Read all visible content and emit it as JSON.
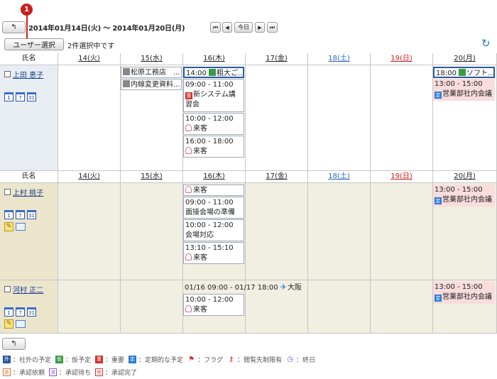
{
  "callout": "1",
  "toolbar": {
    "back_glyph": "↰",
    "date_range": "2014年01月14日(火) 〜 2014年01月20日(月)",
    "nav": [
      "⏮",
      "◀",
      "今日",
      "▶",
      "⏭"
    ]
  },
  "selection": {
    "button": "ユーザー選択",
    "status": "2件選択中です"
  },
  "refresh_glyph": "↻",
  "header": {
    "name_col": "氏名",
    "days": [
      "14(火)",
      "15(水)",
      "16(木)",
      "17(金)",
      "18(土)",
      "19(日)",
      "20(月)"
    ]
  },
  "users": [
    {
      "name": "上田 恵子",
      "icons": [
        "1",
        "7",
        "31"
      ]
    },
    {
      "name": "上村 桃子",
      "icons": [
        "1",
        "7",
        "31"
      ]
    },
    {
      "name": "河村 正二",
      "icons": [
        "1",
        "7",
        "31"
      ]
    }
  ],
  "events": {
    "u1_d15_a": "松原工務店　...",
    "u1_d15_b": "内線変更資料...",
    "u1_d16_a": "14:00 ",
    "u1_d16_a_title": "粗大ご...",
    "u1_d16_b_time": "09:00 - 11:00",
    "u1_d16_b_title": "新システム講習会",
    "u1_d16_c_time": "10:00 - 12:00",
    "u1_d16_c_title": "来客",
    "u1_d16_d_time": "16:00 - 18:00",
    "u1_d16_d_title": "来客",
    "u1_d20_a": "18:00 ",
    "u1_d20_a_title": "ソフト...",
    "u1_d20_b_time": "13:00 - 15:00",
    "u1_d20_b_title": "営業部社内会議",
    "u2_d16_a_title": "来客",
    "u2_d16_b_time": "09:00 - 11:00",
    "u2_d16_b_title": "面接会場の準備",
    "u2_d16_c_time": "10:00 - 12:00",
    "u2_d16_c_title": "会場対応",
    "u2_d16_d_time": "13:10 - 15:10",
    "u2_d16_d_title": "来客",
    "u2_d20_a_time": "13:00 - 15:00",
    "u2_d20_a_title": "営業部社内会議",
    "u3_span_time": "01/16 09:00 - 01/17 18:00 ",
    "u3_span_title": "大阪出張",
    "u3_d16_b_time": "10:00 - 12:00",
    "u3_d16_b_title": "来客",
    "u3_d20_a_time": "13:00 - 15:00",
    "u3_d20_a_title": "営業部社内会議"
  },
  "badges": {
    "important": "重",
    "regular": "定",
    "tentative": "仮",
    "external": "外",
    "memo": "✎"
  },
  "legend": {
    "row1": [
      {
        "badge": "外",
        "text": "：社外の予定"
      },
      {
        "badge": "仮",
        "text": "：仮予定"
      },
      {
        "badge": "重",
        "text": "：重要"
      },
      {
        "badge": "定",
        "text": "：定期的な予定"
      },
      {
        "badge": "⚑",
        "text": "：フラグ"
      },
      {
        "badge": "⚷",
        "text": "：閲覧先制限有"
      },
      {
        "badge": "◷",
        "text": "：終日"
      }
    ],
    "row2": [
      {
        "badge": "依",
        "text": "：承認依頼"
      },
      {
        "badge": "済",
        "text": "：承認待ち"
      },
      {
        "badge": "完",
        "text": "：承認完了"
      }
    ]
  },
  "colors": {
    "accent": "#c8201f",
    "link": "#1a3d8f",
    "saturday": "#2b66c0",
    "sunday": "#c8201f",
    "pink_event": "#f9dcdc"
  }
}
